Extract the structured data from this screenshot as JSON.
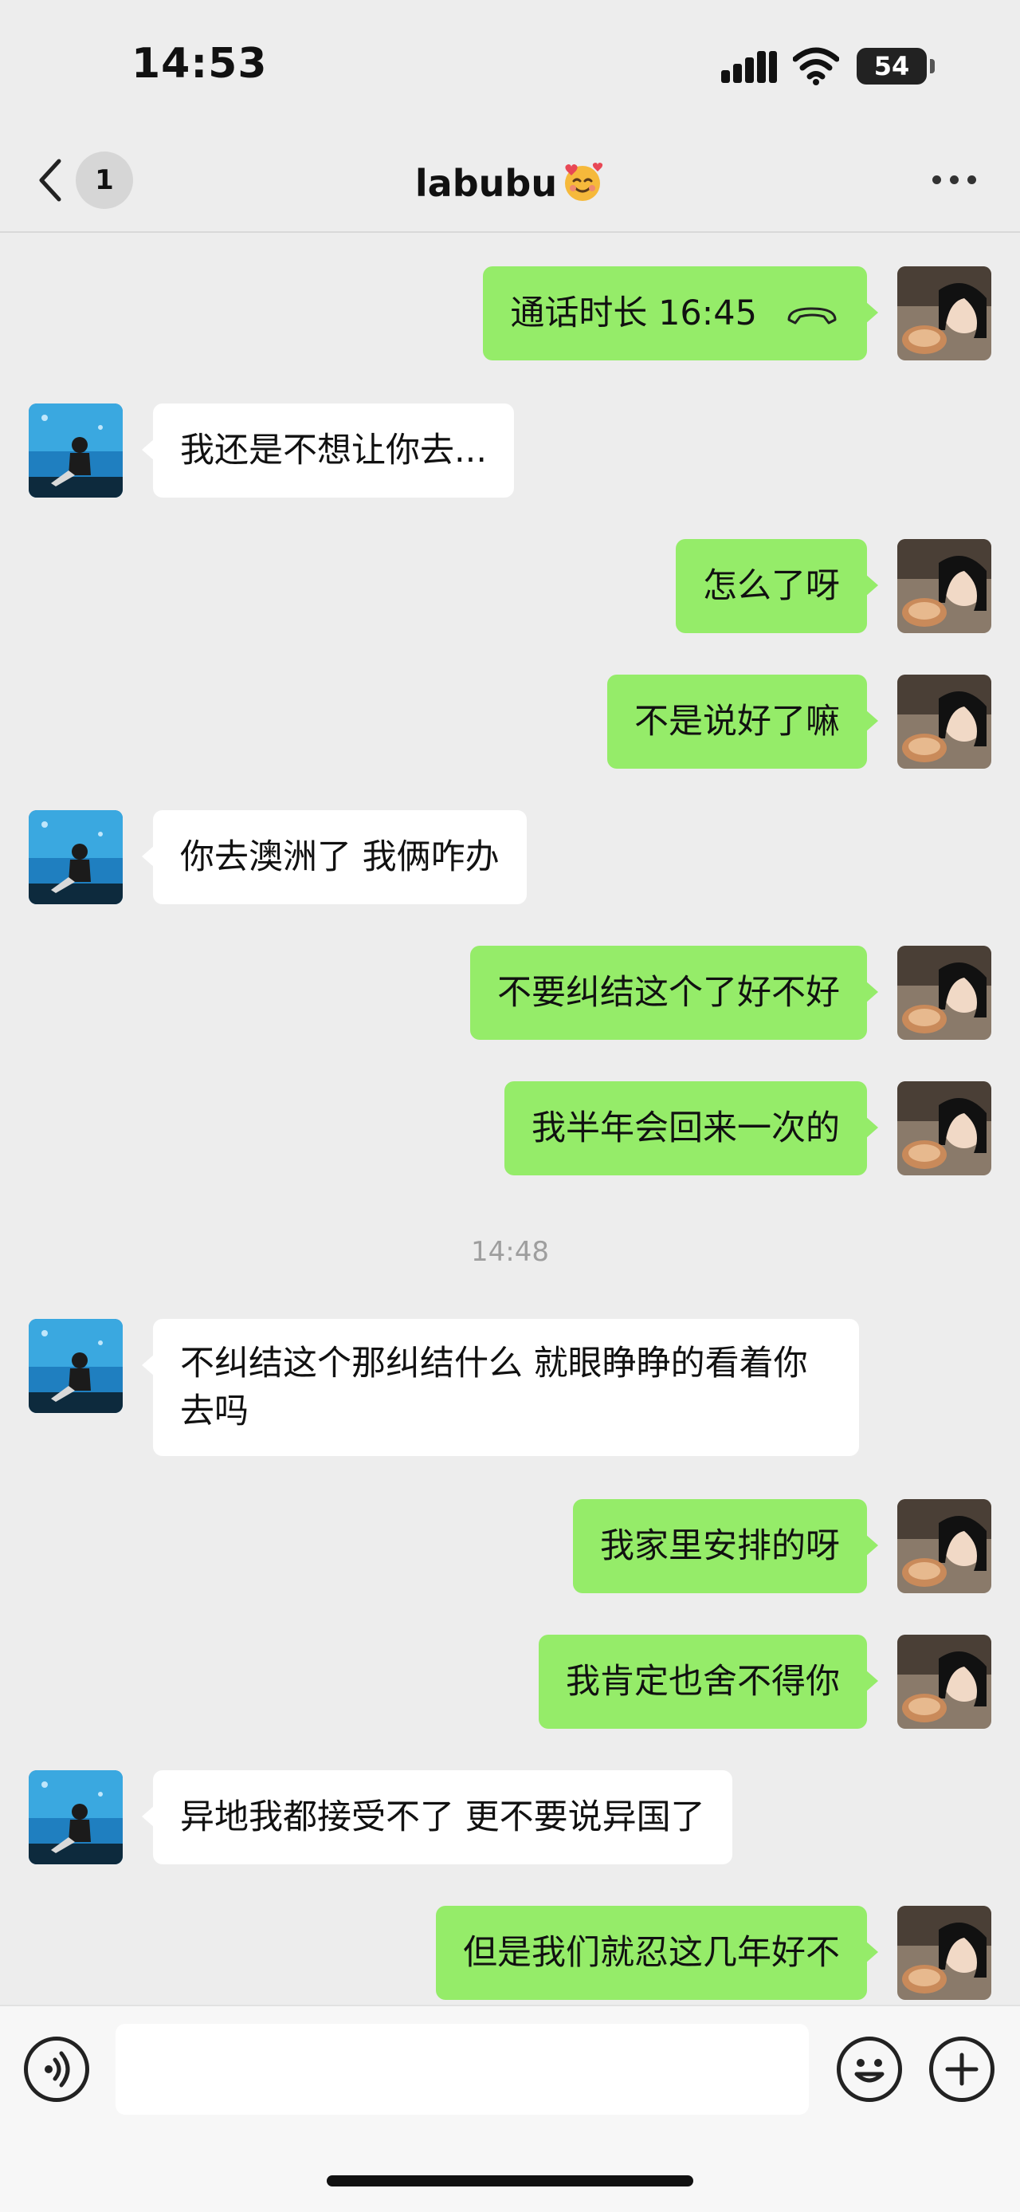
{
  "status_bar": {
    "time": "14:53",
    "battery": "54"
  },
  "header": {
    "back_count": "1",
    "title": "labubu"
  },
  "colors": {
    "sent_bubble": "#95ec69",
    "received_bubble": "#ffffff",
    "background": "#ededed"
  },
  "messages": [
    {
      "text": "通话时长 16:45",
      "side": "right",
      "type": "call",
      "icon": "hang-up-phone-icon"
    },
    {
      "text": "我还是不想让你去...",
      "side": "left"
    },
    {
      "text": "怎么了呀",
      "side": "right"
    },
    {
      "text": "不是说好了嘛",
      "side": "right"
    },
    {
      "text": "你去澳洲了 我俩咋办",
      "side": "left"
    },
    {
      "text": "不要纠结这个了好不好",
      "side": "right"
    },
    {
      "text": "我半年会回来一次的",
      "side": "right"
    },
    {
      "timestamp": "14:48"
    },
    {
      "text": "不纠结这个那纠结什么 就眼睁睁的看着你去吗",
      "side": "left"
    },
    {
      "text": "我家里安排的呀",
      "side": "right"
    },
    {
      "text": "我肯定也舍不得你",
      "side": "right"
    },
    {
      "text": "异地我都接受不了 更不要说异国了",
      "side": "left"
    },
    {
      "text": "但是我们就忍这几年好不",
      "side": "right"
    }
  ],
  "input_bar": {
    "icons": [
      "voice-icon",
      "emoji-icon",
      "plus-icon"
    ]
  }
}
